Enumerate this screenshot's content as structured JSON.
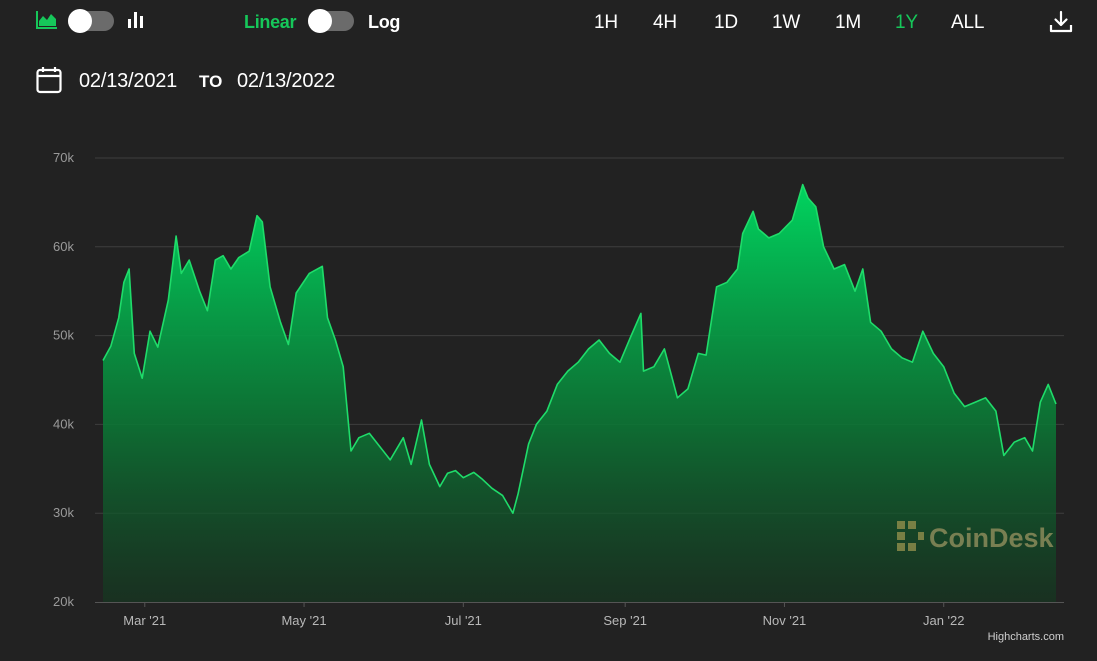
{
  "toolbar": {
    "scale_linear": "Linear",
    "scale_log": "Log",
    "ranges": [
      "1H",
      "4H",
      "1D",
      "1W",
      "1M",
      "1Y",
      "ALL"
    ],
    "active_range": "1Y",
    "accent_color": "#16c75a"
  },
  "date_range": {
    "from": "02/13/2021",
    "separator": "TO",
    "to": "02/13/2022"
  },
  "watermark": "CoinDesk",
  "credits": "Highcharts.com",
  "icons": [
    "area-chart-icon",
    "bar-chart-icon",
    "download-icon",
    "calendar-icon"
  ],
  "chart_data": {
    "type": "area",
    "title": "",
    "xlabel": "",
    "ylabel": "",
    "ylim": [
      20000,
      70000
    ],
    "yticks": [
      20000,
      30000,
      40000,
      50000,
      60000,
      70000
    ],
    "ytick_labels": [
      "20k",
      "30k",
      "40k",
      "50k",
      "60k",
      "70k"
    ],
    "xticks": [
      "2021-03-01",
      "2021-05-01",
      "2021-07-01",
      "2021-09-01",
      "2021-11-01",
      "2022-01-01"
    ],
    "xtick_labels": [
      "Mar '21",
      "May '21",
      "Jul '21",
      "Sep '21",
      "Nov '21",
      "Jan '22"
    ],
    "xlim": [
      "2021-02-13",
      "2022-02-13"
    ],
    "grid": true,
    "series": [
      {
        "color": "#1fdc6a",
        "x": [
          "2021-02-13",
          "2021-02-16",
          "2021-02-19",
          "2021-02-21",
          "2021-02-23",
          "2021-02-25",
          "2021-02-28",
          "2021-03-03",
          "2021-03-06",
          "2021-03-10",
          "2021-03-13",
          "2021-03-15",
          "2021-03-18",
          "2021-03-22",
          "2021-03-25",
          "2021-03-28",
          "2021-03-31",
          "2021-04-03",
          "2021-04-06",
          "2021-04-10",
          "2021-04-13",
          "2021-04-15",
          "2021-04-18",
          "2021-04-22",
          "2021-04-25",
          "2021-04-28",
          "2021-05-03",
          "2021-05-08",
          "2021-05-10",
          "2021-05-13",
          "2021-05-16",
          "2021-05-19",
          "2021-05-22",
          "2021-05-26",
          "2021-05-30",
          "2021-06-03",
          "2021-06-08",
          "2021-06-11",
          "2021-06-15",
          "2021-06-18",
          "2021-06-22",
          "2021-06-25",
          "2021-06-28",
          "2021-07-01",
          "2021-07-05",
          "2021-07-08",
          "2021-07-12",
          "2021-07-16",
          "2021-07-20",
          "2021-07-22",
          "2021-07-26",
          "2021-07-29",
          "2021-08-02",
          "2021-08-06",
          "2021-08-10",
          "2021-08-14",
          "2021-08-18",
          "2021-08-22",
          "2021-08-26",
          "2021-08-30",
          "2021-09-03",
          "2021-09-07",
          "2021-09-08",
          "2021-09-12",
          "2021-09-16",
          "2021-09-21",
          "2021-09-25",
          "2021-09-29",
          "2021-10-02",
          "2021-10-06",
          "2021-10-10",
          "2021-10-14",
          "2021-10-16",
          "2021-10-20",
          "2021-10-22",
          "2021-10-26",
          "2021-10-30",
          "2021-11-04",
          "2021-11-08",
          "2021-11-10",
          "2021-11-13",
          "2021-11-16",
          "2021-11-20",
          "2021-11-24",
          "2021-11-28",
          "2021-12-01",
          "2021-12-04",
          "2021-12-08",
          "2021-12-12",
          "2021-12-16",
          "2021-12-20",
          "2021-12-24",
          "2021-12-28",
          "2022-01-01",
          "2022-01-05",
          "2022-01-09",
          "2022-01-13",
          "2022-01-17",
          "2022-01-21",
          "2022-01-24",
          "2022-01-28",
          "2022-02-01",
          "2022-02-04",
          "2022-02-07",
          "2022-02-10",
          "2022-02-13"
        ],
        "values": [
          47200,
          48800,
          52000,
          56000,
          57500,
          48000,
          45200,
          50500,
          48700,
          54000,
          61200,
          57000,
          58500,
          55000,
          52800,
          58500,
          59000,
          57500,
          58800,
          59500,
          63500,
          62800,
          55500,
          51500,
          49000,
          54800,
          57000,
          57800,
          52000,
          49500,
          46500,
          37000,
          38500,
          39000,
          37500,
          36000,
          38500,
          35500,
          40500,
          35500,
          33000,
          34500,
          34800,
          34000,
          34600,
          33900,
          32800,
          32000,
          30000,
          32200,
          37800,
          40000,
          41500,
          44500,
          46000,
          47000,
          48500,
          49500,
          48000,
          47000,
          49800,
          52500,
          46000,
          46500,
          48500,
          43000,
          44000,
          48000,
          47800,
          55500,
          56000,
          57500,
          61500,
          64000,
          62000,
          61000,
          61500,
          63000,
          67000,
          65500,
          64500,
          60000,
          57500,
          58000,
          55000,
          57500,
          51500,
          50500,
          48500,
          47500,
          47000,
          50500,
          48000,
          46500,
          43500,
          42000,
          42500,
          43000,
          41500,
          36500,
          38000,
          38500,
          37000,
          42500,
          44500,
          42300
        ]
      }
    ]
  }
}
